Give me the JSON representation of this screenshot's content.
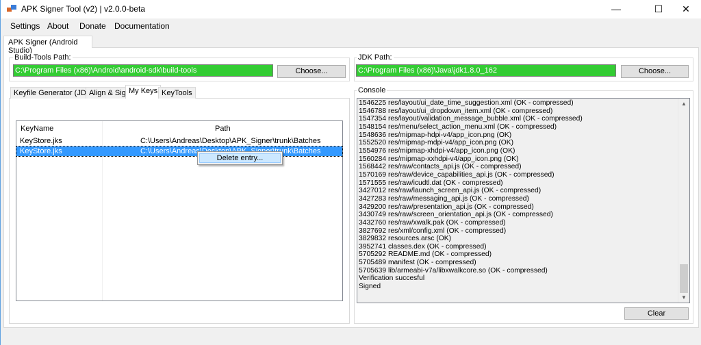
{
  "window": {
    "title": "APK Signer Tool (v2) | v2.0.0-beta",
    "minimize": "—",
    "maximize": "☐",
    "close": "✕"
  },
  "menu": [
    "Settings",
    "About",
    "Donate",
    "Documentation"
  ],
  "main_tab": "APK Signer (Android Studio)",
  "build_tools": {
    "label": "Build-Tools Path:",
    "value": "C:\\Program Files (x86)\\Android\\android-sdk\\build-tools",
    "button": "Choose..."
  },
  "jdk": {
    "label": "JDK Path:",
    "value": "C:\\Program Files (x86)\\Java\\jdk1.8.0_162",
    "button": "Choose..."
  },
  "inner_tabs": [
    "Keyfile Generator (JDK)",
    "Align & Sign",
    "My Keys",
    "KeyTools"
  ],
  "selected_inner_tab": "My Keys",
  "keys": {
    "columns": [
      "KeyName",
      "Path"
    ],
    "rows": [
      {
        "name": "KeyStore.jks",
        "path": "C:\\Users\\Andreas\\Desktop\\APK_Signer\\trunk\\Batches",
        "selected": false
      },
      {
        "name": "KeyStore.jks",
        "path": "C:\\Users\\Andreas\\Desktop\\APK_Signer\\trunk\\Batches",
        "selected": true
      }
    ]
  },
  "context_menu": {
    "item": "Delete entry..."
  },
  "console": {
    "label": "Console",
    "button": "Clear",
    "lines": [
      "1546225 res/layout/ui_date_time_suggestion.xml (OK - compressed)",
      "1546788 res/layout/ui_dropdown_item.xml (OK - compressed)",
      "1547354 res/layout/validation_message_bubble.xml (OK - compressed)",
      "1548154 res/menu/select_action_menu.xml (OK - compressed)",
      "1548636 res/mipmap-hdpi-v4/app_icon.png (OK)",
      "1552520 res/mipmap-mdpi-v4/app_icon.png (OK)",
      "1554976 res/mipmap-xhdpi-v4/app_icon.png (OK)",
      "1560284 res/mipmap-xxhdpi-v4/app_icon.png (OK)",
      "1568442 res/raw/contacts_api.js (OK - compressed)",
      "1570169 res/raw/device_capabilities_api.js (OK - compressed)",
      "1571555 res/raw/icudtl.dat (OK - compressed)",
      "3427012 res/raw/launch_screen_api.js (OK - compressed)",
      "3427283 res/raw/messaging_api.js (OK - compressed)",
      "3429200 res/raw/presentation_api.js (OK - compressed)",
      "3430749 res/raw/screen_orientation_api.js (OK - compressed)",
      "3432760 res/raw/xwalk.pak (OK - compressed)",
      "3827692 res/xml/config.xml (OK - compressed)",
      "3829832 resources.arsc (OK)",
      "3952741 classes.dex (OK - compressed)",
      "5705292 README.md (OK - compressed)",
      "5705489 manifest (OK - compressed)",
      "5705639 lib/armeabi-v7a/libxwalkcore.so (OK - compressed)",
      "Verification succesful",
      "Signed"
    ]
  },
  "colors": {
    "path_ok": "#33cc33",
    "selection": "#3399ff"
  }
}
